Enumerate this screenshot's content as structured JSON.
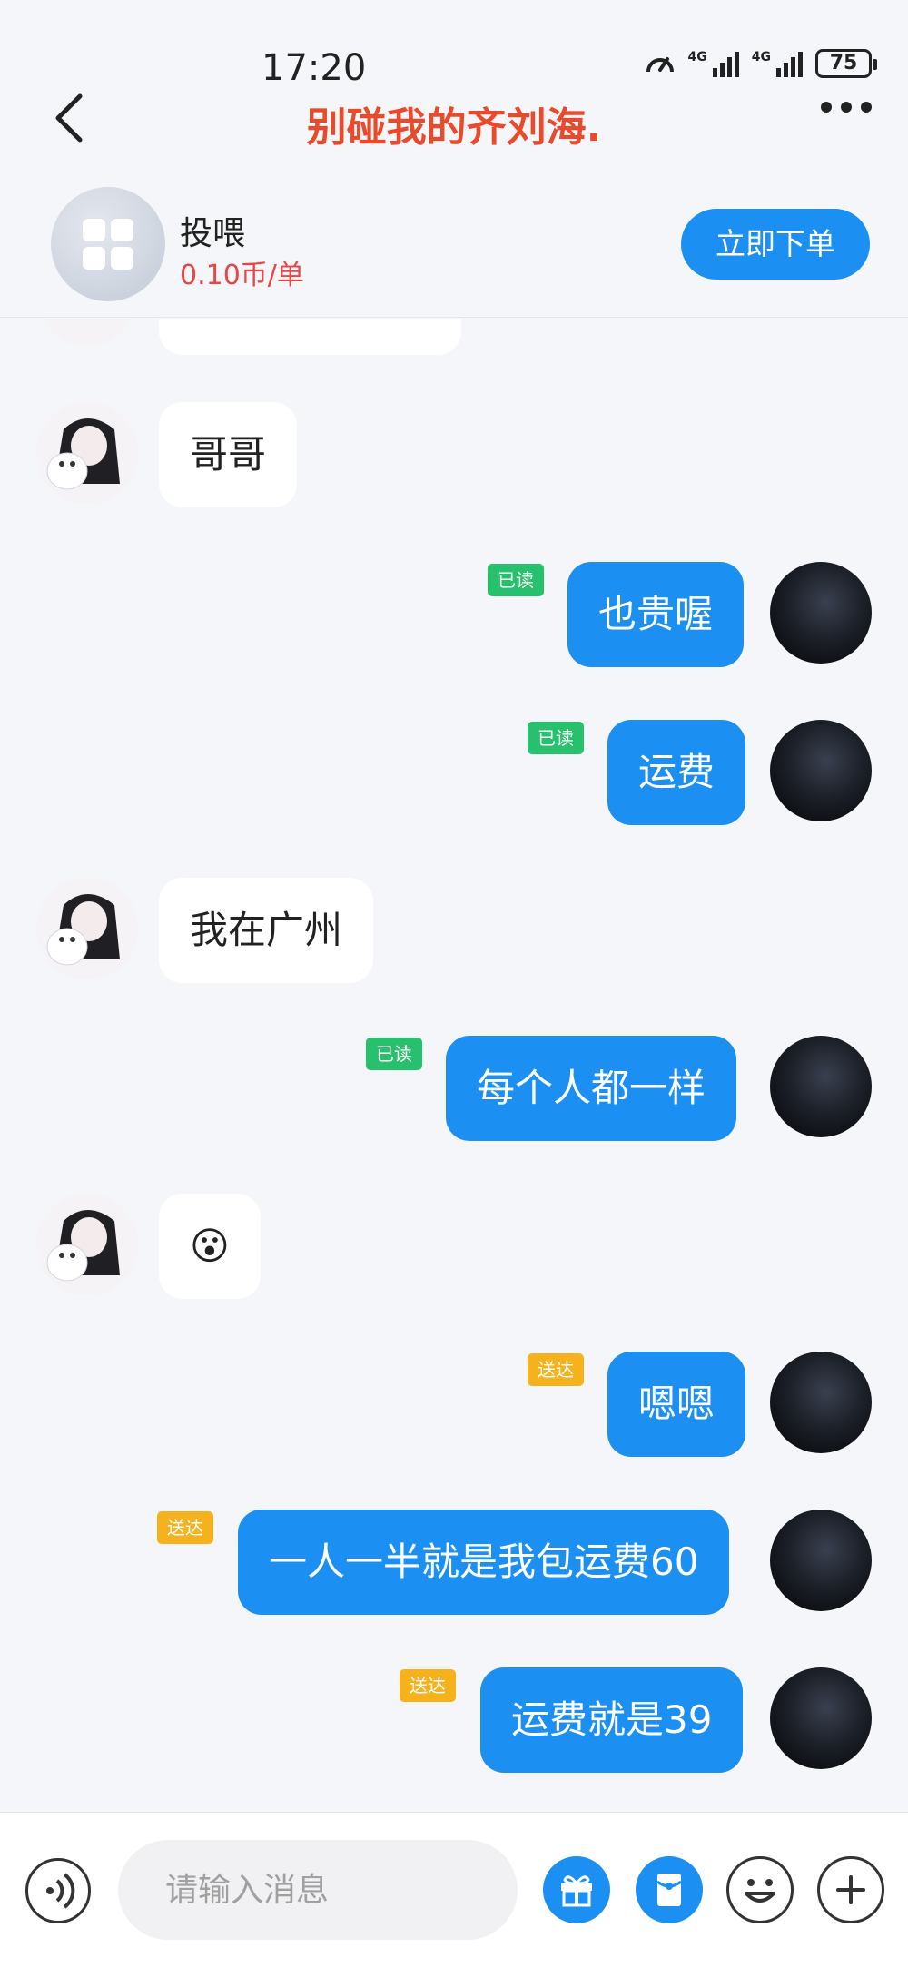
{
  "status_bar": {
    "time": "17:20",
    "signal1_label": "4G",
    "signal2_label": "4G",
    "battery": "75"
  },
  "nav": {
    "title": "别碰我的齐刘海.",
    "title_color": "#ea4a2c"
  },
  "product": {
    "name": "投喂",
    "price": "0.10币/单",
    "order_button": "立即下单"
  },
  "messages": [
    {
      "side": "in",
      "text": "哥哥"
    },
    {
      "side": "out",
      "text": "也贵喔",
      "status": "已读"
    },
    {
      "side": "out",
      "text": "运费",
      "status": "已读"
    },
    {
      "side": "in",
      "text": "我在广州"
    },
    {
      "side": "out",
      "text": "每个人都一样",
      "status": "已读"
    },
    {
      "side": "in",
      "text": "😮"
    },
    {
      "side": "out",
      "text": "嗯嗯",
      "status": "送达"
    },
    {
      "side": "out",
      "text": "一人一半就是我包运费60",
      "status": "送达"
    },
    {
      "side": "out",
      "text": "运费就是39",
      "status": "送达"
    }
  ],
  "input": {
    "placeholder": "请输入消息"
  },
  "colors": {
    "accent": "#1c8ff2",
    "read_badge": "#27c06c",
    "delivered_badge": "#f6b21d",
    "price": "#e94545"
  },
  "icons": {
    "back": "chevron-left-icon",
    "more": "more-dots-icon",
    "voice": "voice-icon",
    "gift": "gift-icon",
    "red_packet": "red-packet-icon",
    "emoji": "emoji-icon",
    "plus": "plus-icon"
  }
}
